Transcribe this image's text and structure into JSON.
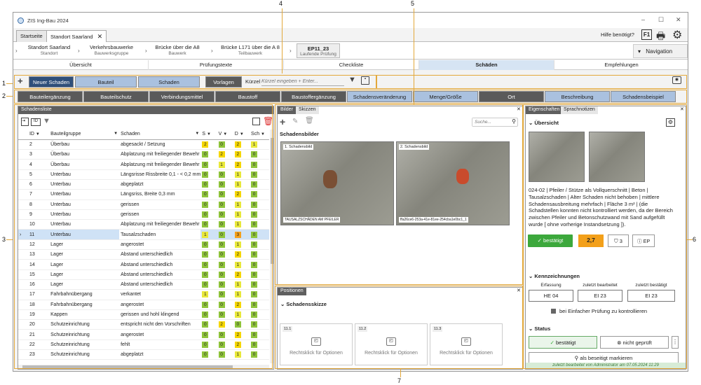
{
  "window": {
    "title": "ZIS Ing-Bau 2024"
  },
  "doc_tabs": [
    "Startseite",
    "Standort Saarland"
  ],
  "help": "Hilfe benötigt?",
  "breadcrumb": [
    {
      "title": "Standort Saarland",
      "sub": "Standort"
    },
    {
      "title": "Verkehrsbauwerke",
      "sub": "Bauwerksgruppe"
    },
    {
      "title": "Brücke über die A8",
      "sub": "Bauwerk"
    },
    {
      "title": "Brücke L171 über die A 8",
      "sub": "Teilbauwerk"
    },
    {
      "title": "EP11_23",
      "sub": "Laufende Prüfung"
    }
  ],
  "navigation_label": "Navigation",
  "nav_tabs": [
    "Übersicht",
    "Prüfungstexte",
    "Checkliste",
    "Schäden",
    "Empfehlungen"
  ],
  "toolbar1": {
    "new": "Neuer Schaden",
    "bauteil": "Bauteil",
    "schaden": "Schaden",
    "vorlagen": "Vorlagen",
    "kurzel": "Kürzel",
    "kurzel_placeholder": "Kürzel eingeben + Enter..."
  },
  "toolbar2": [
    "Bauteilergänzung",
    "Bauteilschutz",
    "Verbindungsmittel",
    "Baustoff",
    "Baustoffergänzung",
    "Schadensveränderung",
    "Menge/Größe",
    "Ort",
    "Beschreibung",
    "Schadensbeispiel"
  ],
  "list": {
    "title": "Schadensliste",
    "headers": [
      "ID",
      "Bauteilgruppe",
      "Schaden",
      "S",
      "V",
      "D",
      "Sch"
    ],
    "rows": [
      [
        "2",
        "Überbau",
        "abgesackt / Setzung",
        "2",
        "0",
        "2",
        "1"
      ],
      [
        "3",
        "Überbau",
        "Abplatzung mit freiliegender Bewehr",
        "0",
        "2",
        "2",
        "0"
      ],
      [
        "4",
        "Überbau",
        "Abplatzung mit freiliegender Bewehr",
        "0",
        "1",
        "2",
        "0"
      ],
      [
        "5",
        "Unterbau",
        "Längsrisse Rissbreite 0,1 - < 0,2 mm",
        "0",
        "0",
        "1",
        "0"
      ],
      [
        "6",
        "Unterbau",
        "abgeplatzt",
        "0",
        "0",
        "1",
        "0"
      ],
      [
        "7",
        "Unterbau",
        "Längsriss, Breite 0,3 mm",
        "0",
        "0",
        "2",
        "0"
      ],
      [
        "8",
        "Unterbau",
        "gerissen",
        "0",
        "0",
        "1",
        "0"
      ],
      [
        "9",
        "Unterbau",
        "gerissen",
        "0",
        "0",
        "1",
        "0"
      ],
      [
        "10",
        "Unterbau",
        "Abplatzung mit freiliegender Bewehr",
        "0",
        "0",
        "1",
        "0"
      ],
      [
        "11",
        "Unterbau",
        "Tausalzschaden",
        "1",
        "0",
        "3",
        "0"
      ],
      [
        "12",
        "Lager",
        "angerostet",
        "0",
        "0",
        "1",
        "0"
      ],
      [
        "13",
        "Lager",
        "Abstand unterschiedlich",
        "0",
        "0",
        "2",
        "0"
      ],
      [
        "14",
        "Lager",
        "Abstand unterschiedlich",
        "0",
        "0",
        "1",
        "0"
      ],
      [
        "15",
        "Lager",
        "Abstand unterschiedlich",
        "0",
        "0",
        "2",
        "0"
      ],
      [
        "16",
        "Lager",
        "Abstand unterschiedlich",
        "0",
        "0",
        "1",
        "0"
      ],
      [
        "17",
        "Fahrbahnübergang",
        "verkantet",
        "1",
        "0",
        "1",
        "0"
      ],
      [
        "18",
        "Fahrbahnübergang",
        "angerostet",
        "0",
        "0",
        "2",
        "0"
      ],
      [
        "19",
        "Kappen",
        "gerissen und hohl klingend",
        "0",
        "0",
        "1",
        "0"
      ],
      [
        "20",
        "Schutzeinrichtung",
        "entspricht nicht den Vorschriften",
        "0",
        "2",
        "0",
        "0"
      ],
      [
        "21",
        "Schutzeinrichtung",
        "angerostet",
        "0",
        "0",
        "2",
        "0"
      ],
      [
        "22",
        "Schutzeinrichtung",
        "fehlt",
        "0",
        "0",
        "2",
        "0"
      ],
      [
        "23",
        "Schutzeinrichtung",
        "abgeplatzt",
        "0",
        "0",
        "1",
        "0"
      ]
    ]
  },
  "images": {
    "tabs": [
      "Bilder",
      "Skizzen"
    ],
    "search_placeholder": "Suche...",
    "title": "Schadensbilder",
    "img1_label": "1. Schadensbild",
    "img1_caption": "TAUSALZSCHÄDEN AM PFEILER",
    "img2_label": "2. Schadensbild",
    "img2_caption": "ffa26ce6-253a-41e-81ee-254cba1e0bc1_1"
  },
  "positions": {
    "tab": "Positionen",
    "title": "Schadensskizze",
    "boxes": [
      {
        "n": "11.1",
        "l": "Rechtsklick für Optionen"
      },
      {
        "n": "11.2",
        "l": "Rechtsklick für Optionen"
      },
      {
        "n": "11.3",
        "l": "Rechtsklick für Optionen"
      }
    ]
  },
  "props": {
    "tabs": [
      "Eigenschaften",
      "Sprachnotizen"
    ],
    "overview": "Übersicht",
    "description": "024-02 | Pfeiler / Stütze als Vollquerschnitt | Beton | Tausalzschaden | Alter Schaden nicht behoben | mittlere Schadensausbreitung mehrfach | Fläche 3 m² | (die Schadstellen konnten nicht  kontrolliert werden, da der Bereich zwischen Pfeiler und Betonschutzwand mit Sand aufgefüllt wurde [ ohne vorherige Instandsetzung ]).",
    "confirmed": "bestätigt",
    "score": "2,7",
    "count": "3",
    "ep": "EP",
    "marks_title": "Kennzeichnungen",
    "marks": [
      {
        "label": "Erfassung",
        "value": "HE 04"
      },
      {
        "label": "zuletzt bearbeitet",
        "value": "EI 23"
      },
      {
        "label": "zuletzt bestätigt",
        "value": "EI 23"
      }
    ],
    "simple_check": "bei Einfacher Prüfung zu kontrollieren",
    "status_title": "Status",
    "status_confirmed": "bestätigt",
    "status_not_checked": "nicht geprüft",
    "mark_fixed": "als beseitigt markieren",
    "footer": "zuletzt bearbeitet von Administrator am 07.05.2024 11:29"
  },
  "callouts": [
    "1",
    "2",
    "3",
    "4",
    "5",
    "6",
    "7"
  ],
  "colors": {
    "accent": "#e3a83a",
    "header": "#5f5f5f",
    "navy": "#2f4f7a",
    "btnblue": "#aac1df",
    "ok": "#3ca83c",
    "score": "#f3a01a"
  }
}
